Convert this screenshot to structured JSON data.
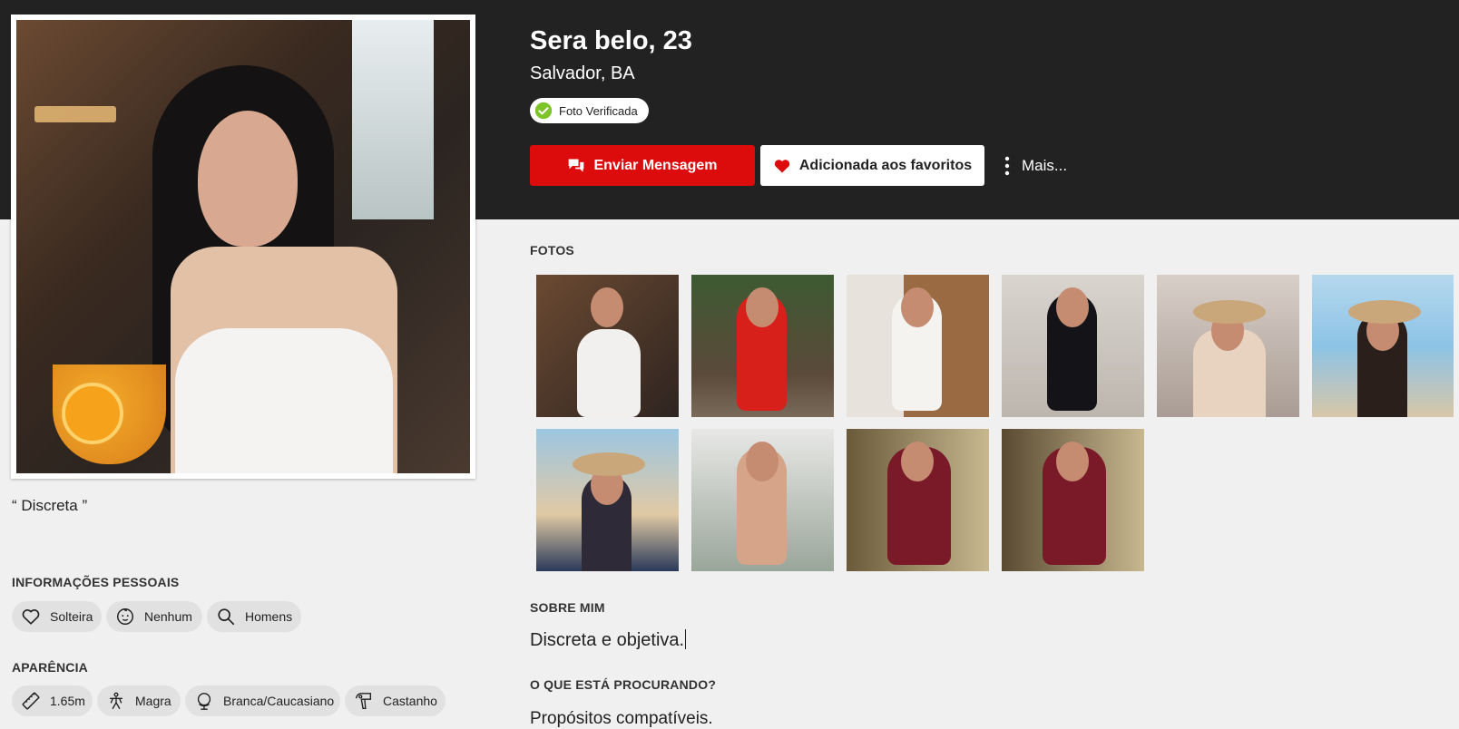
{
  "profile": {
    "name_age": "Sera belo, 23",
    "location": "Salvador, BA",
    "verified_label": "Foto Verificada",
    "quote": "“ Discreta ”"
  },
  "actions": {
    "message_label": "Enviar Mensagem",
    "favorite_label": "Adicionada aos favoritos",
    "more_label": "Mais..."
  },
  "personal_info": {
    "title": "INFORMAÇÕES PESSOAIS",
    "chips": [
      {
        "label": "Solteira",
        "icon": "heart-outline-icon"
      },
      {
        "label": "Nenhum",
        "icon": "baby-face-icon"
      },
      {
        "label": "Homens",
        "icon": "search-icon"
      }
    ]
  },
  "appearance": {
    "title": "APARÊNCIA",
    "chips": [
      {
        "label": "1.65m",
        "icon": "ruler-icon"
      },
      {
        "label": "Magra",
        "icon": "body-figure-icon"
      },
      {
        "label": "Branca/Caucasiano",
        "icon": "globe-icon"
      },
      {
        "label": "Castanho",
        "icon": "hair-dryer-icon"
      }
    ]
  },
  "photos": {
    "title": "FOTOS",
    "count": 10
  },
  "about": {
    "title": "SOBRE MIM",
    "text": "Discreta e objetiva."
  },
  "looking_for": {
    "title": "O QUE ESTÁ PROCURANDO?",
    "text": "Propósitos compatíveis."
  },
  "colors": {
    "header_bg": "#222222",
    "page_bg": "#f0f0f0",
    "primary_red": "#dc0c0c",
    "chip_bg": "#e1e1e1",
    "verified_green": "#7cc428"
  }
}
